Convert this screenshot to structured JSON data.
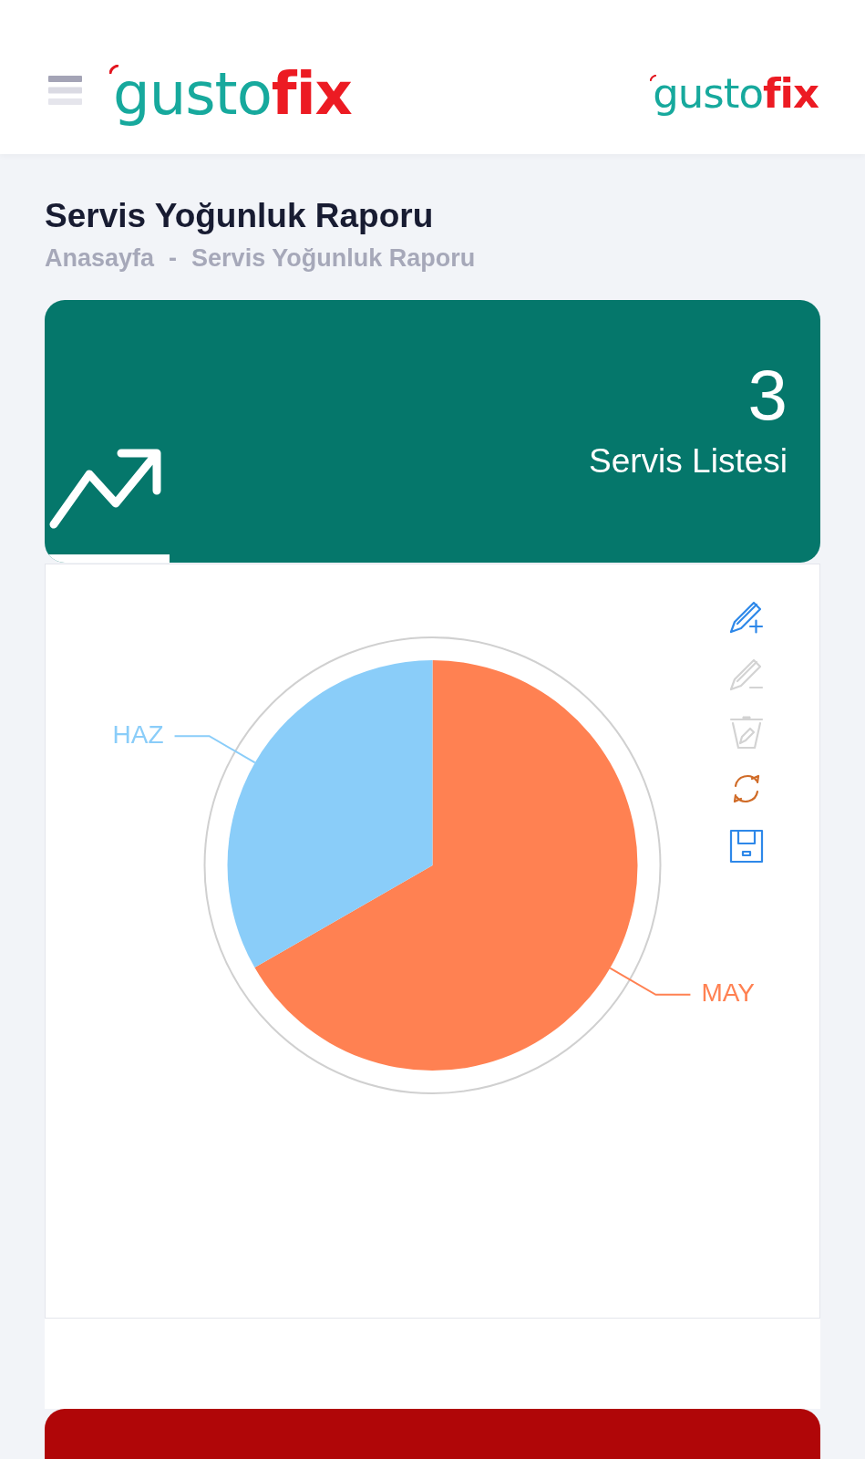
{
  "header": {
    "logo": {
      "part_1": "gusto",
      "part_2": "fix"
    },
    "logo_right": {
      "part_1": "gusto",
      "part_2": "fix"
    }
  },
  "page_title": "Servis Yoğunluk Raporu",
  "breadcrumb": {
    "items": [
      "Anasayfa",
      "Servis Yoğunluk Raporu"
    ],
    "separator": "-"
  },
  "stat_card": {
    "value": "3",
    "label": "Servis Listesi"
  },
  "chart_panel": {
    "chart_toolbar": [
      {
        "kind": "pencil_plus",
        "disabled": false
      },
      {
        "kind": "pencil_minus",
        "disabled": true
      },
      {
        "kind": "trash",
        "disabled": true
      },
      {
        "kind": "refresh",
        "disabled": false
      },
      {
        "kind": "save",
        "disabled": false
      }
    ],
    "chart_data": {
      "type": "pie",
      "categories": [
        "MAY",
        "HAZ"
      ],
      "values": [
        66.7,
        33.3
      ],
      "colors": [
        "#ff8152",
        "#8acdf9"
      ]
    }
  }
}
